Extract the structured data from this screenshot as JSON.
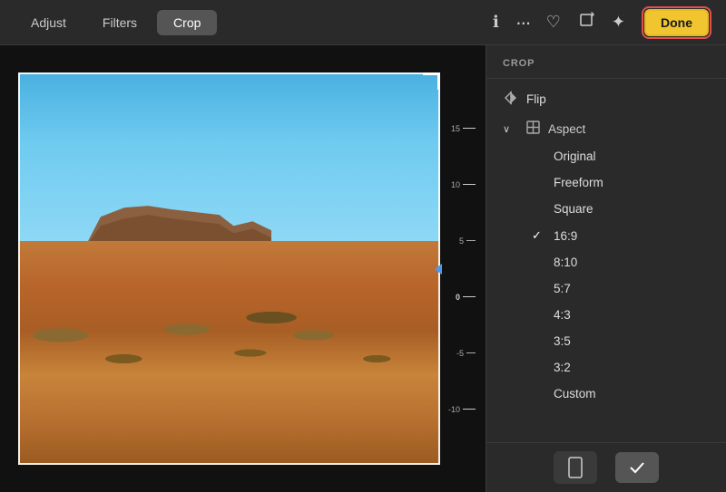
{
  "topBar": {
    "tabs": [
      {
        "id": "adjust",
        "label": "Adjust",
        "active": false
      },
      {
        "id": "filters",
        "label": "Filters",
        "active": false
      },
      {
        "id": "crop",
        "label": "Crop",
        "active": true
      }
    ],
    "icons": [
      {
        "id": "info",
        "symbol": "ℹ",
        "name": "info-icon"
      },
      {
        "id": "more",
        "symbol": "···",
        "name": "more-icon"
      },
      {
        "id": "heart",
        "symbol": "♡",
        "name": "heart-icon"
      },
      {
        "id": "crop-rotate",
        "symbol": "⤢",
        "name": "crop-rotate-icon"
      },
      {
        "id": "magic",
        "symbol": "✦",
        "name": "magic-icon"
      }
    ],
    "doneButton": "Done"
  },
  "rightPanel": {
    "header": "CROP",
    "items": [
      {
        "id": "flip",
        "label": "Flip",
        "type": "action",
        "icon": "⇅",
        "indent": false
      },
      {
        "id": "aspect",
        "label": "Aspect",
        "type": "section",
        "icon": "▦",
        "expanded": true,
        "chevron": "∨"
      },
      {
        "id": "original",
        "label": "Original",
        "type": "sub",
        "checked": false
      },
      {
        "id": "freeform",
        "label": "Freeform",
        "type": "sub",
        "checked": false
      },
      {
        "id": "square",
        "label": "Square",
        "type": "sub",
        "checked": false
      },
      {
        "id": "16:9",
        "label": "16:9",
        "type": "sub",
        "checked": true
      },
      {
        "id": "8:10",
        "label": "8:10",
        "type": "sub",
        "checked": false
      },
      {
        "id": "5:7",
        "label": "5:7",
        "type": "sub",
        "checked": false
      },
      {
        "id": "4:3",
        "label": "4:3",
        "type": "sub",
        "checked": false
      },
      {
        "id": "3:5",
        "label": "3:5",
        "type": "sub",
        "checked": false
      },
      {
        "id": "3:2",
        "label": "3:2",
        "type": "sub",
        "checked": false
      },
      {
        "id": "custom",
        "label": "Custom",
        "type": "sub",
        "checked": false
      }
    ],
    "bottomBar": {
      "portraitLabel": "Portrait",
      "checkLabel": "Confirm"
    }
  },
  "ruler": {
    "ticks": [
      "15",
      "10",
      "5",
      "0",
      "-5",
      "-10"
    ]
  }
}
